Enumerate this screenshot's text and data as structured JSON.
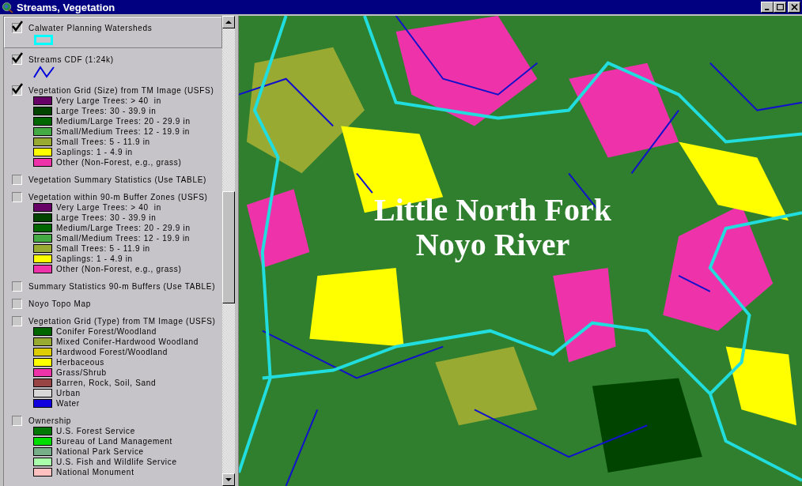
{
  "window": {
    "title": "Streams, Vegetation"
  },
  "layers": [
    {
      "name": "Calwater Planning Watersheds",
      "checked": true,
      "selected": true,
      "kind": "polygon"
    },
    {
      "name": "Streams CDF (1:24k)",
      "checked": true,
      "selected": false,
      "kind": "line"
    },
    {
      "name": "Vegetation Grid (Size) from TM Image (USFS)",
      "checked": true,
      "selected": false,
      "kind": "classes",
      "classes": [
        {
          "label": "Very Large Trees: > 40  in",
          "color": "#660066"
        },
        {
          "label": "Large Trees: 30 - 39.9 in",
          "color": "#004400"
        },
        {
          "label": "Medium/Large Trees: 20 - 29.9 in",
          "color": "#006600"
        },
        {
          "label": "Small/Medium Trees: 12 - 19.9 in",
          "color": "#44aa44"
        },
        {
          "label": "Small Trees: 5 - 11.9 in",
          "color": "#99aa33"
        },
        {
          "label": "Saplings: 1 - 4.9 in",
          "color": "#ffff00"
        },
        {
          "label": "Other (Non-Forest, e.g., grass)",
          "color": "#ee33aa"
        }
      ]
    },
    {
      "name": "Vegetation Summary Statistics (Use TABLE)",
      "checked": false,
      "selected": false,
      "kind": "none"
    },
    {
      "name": "Vegetation within 90-m Buffer Zones (USFS)",
      "checked": false,
      "selected": false,
      "kind": "classes",
      "classes": [
        {
          "label": "Very Large Trees: > 40  in",
          "color": "#660066"
        },
        {
          "label": "Large Trees: 30 - 39.9 in",
          "color": "#004400"
        },
        {
          "label": "Medium/Large Trees: 20 - 29.9 in",
          "color": "#006600"
        },
        {
          "label": "Small/Medium Trees: 12 - 19.9 in",
          "color": "#44aa44"
        },
        {
          "label": "Small Trees: 5 - 11.9 in",
          "color": "#99aa33"
        },
        {
          "label": "Saplings: 1 - 4.9 in",
          "color": "#ffff00"
        },
        {
          "label": "Other (Non-Forest, e.g., grass)",
          "color": "#ee33aa"
        }
      ]
    },
    {
      "name": "Summary Statistics 90-m Buffers (Use TABLE)",
      "checked": false,
      "selected": false,
      "kind": "none"
    },
    {
      "name": "Noyo Topo Map",
      "checked": false,
      "selected": false,
      "kind": "none"
    },
    {
      "name": "Vegetation Grid (Type) from TM Image (USFS)",
      "checked": false,
      "selected": false,
      "kind": "classes",
      "classes": [
        {
          "label": "Conifer Forest/Woodland",
          "color": "#006600"
        },
        {
          "label": "Mixed Conifer-Hardwood Woodland",
          "color": "#99aa33"
        },
        {
          "label": "Hardwood Forest/Woodland",
          "color": "#ddcc00"
        },
        {
          "label": "Herbaceous",
          "color": "#ffff00"
        },
        {
          "label": "Grass/Shrub",
          "color": "#ee33aa"
        },
        {
          "label": "Barren, Rock, Soil, Sand",
          "color": "#994444"
        },
        {
          "label": "Urban",
          "color": "#d8d8d8"
        },
        {
          "label": "Water",
          "color": "#1100dd"
        }
      ]
    },
    {
      "name": "Ownership",
      "checked": false,
      "selected": false,
      "kind": "classes",
      "classes": [
        {
          "label": "U.S. Forest Service",
          "color": "#007700"
        },
        {
          "label": "Bureau of Land Management",
          "color": "#00dd00"
        },
        {
          "label": "National Park Service",
          "color": "#77b088"
        },
        {
          "label": "U.S. Fish and Wildlife Service",
          "color": "#aaffaa"
        },
        {
          "label": "National Monument",
          "color": "#ffc0c0"
        }
      ]
    }
  ],
  "map": {
    "label_lines": [
      "Little North Fork",
      "Noyo River"
    ]
  }
}
